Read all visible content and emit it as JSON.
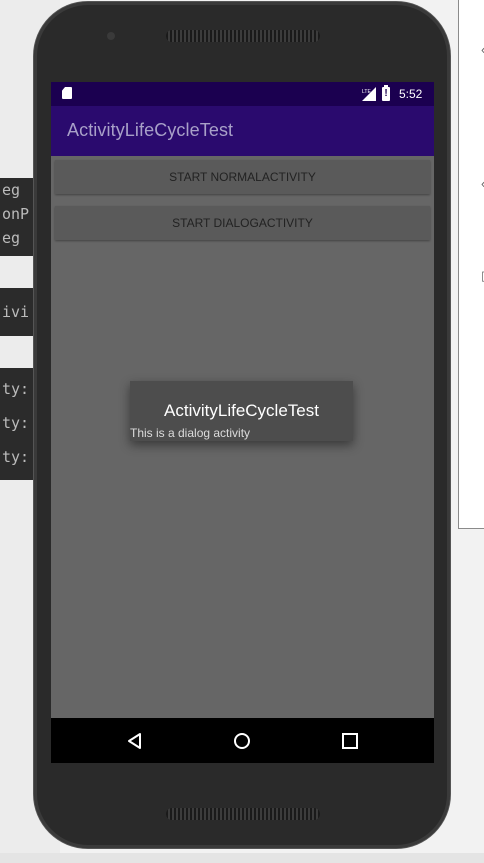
{
  "ide": {
    "code_lines_top": [
      "eg",
      "onP",
      "eg"
    ],
    "code_lines_mid": [
      "ivi"
    ],
    "code_lines_bottom": [
      "ty:",
      "ty:",
      "ty:"
    ]
  },
  "status_bar": {
    "network_label": "LTE",
    "time": "5:52",
    "background": "#1b0050"
  },
  "app_bar": {
    "title": "ActivityLifeCycleTest",
    "background": "#2a0a6e"
  },
  "buttons": {
    "normal_label": "START NORMALACTIVITY",
    "dialog_label": "START DIALOGACTIVITY"
  },
  "dialog": {
    "title": "ActivityLifeCycleTest",
    "message": "This is a dialog activity"
  },
  "nav_bar": {
    "back_icon": "back-triangle-icon",
    "home_icon": "home-circle-icon",
    "recent_icon": "recents-square-icon"
  }
}
